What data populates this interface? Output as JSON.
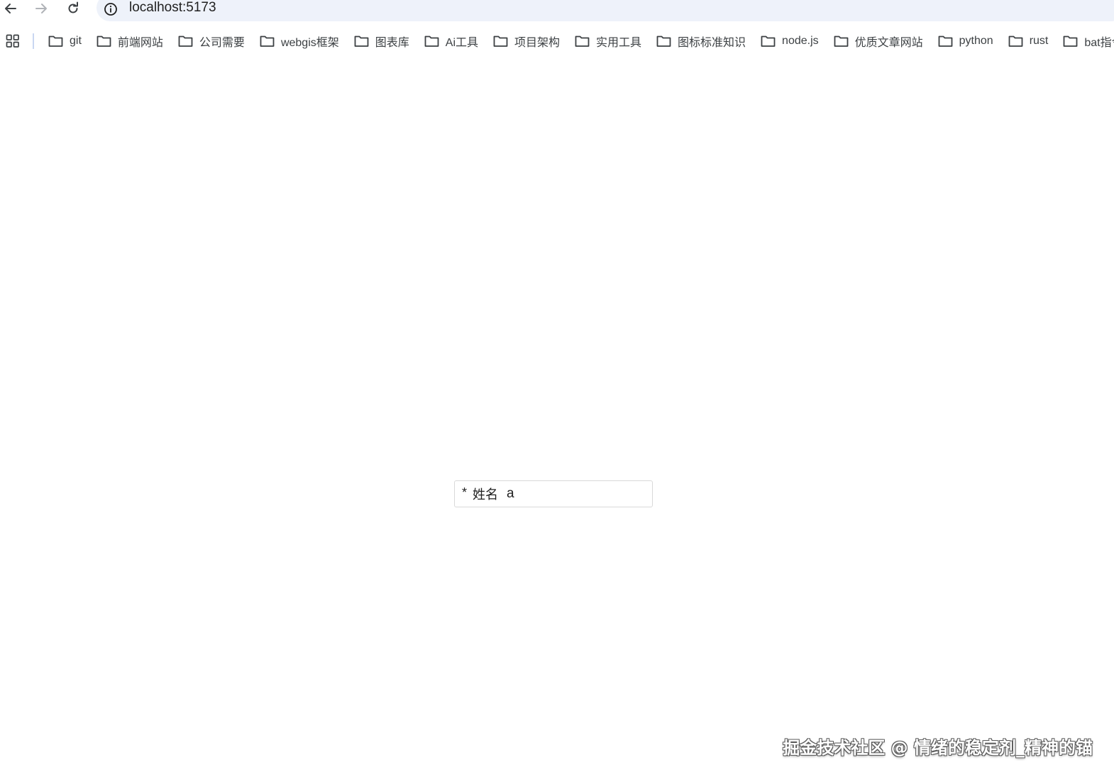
{
  "browser": {
    "url": "localhost:5173",
    "back_icon": "arrow-left-icon",
    "forward_icon": "arrow-right-icon",
    "reload_icon": "reload-icon",
    "site_info_icon": "info-icon"
  },
  "bookmarks": {
    "apps_icon": "apps-grid-icon",
    "items": [
      {
        "label": "git"
      },
      {
        "label": "前端网站"
      },
      {
        "label": "公司需要"
      },
      {
        "label": "webgis框架"
      },
      {
        "label": "图表库"
      },
      {
        "label": "Ai工具"
      },
      {
        "label": "项目架构"
      },
      {
        "label": "实用工具"
      },
      {
        "label": "图标标准知识"
      },
      {
        "label": "node.js"
      },
      {
        "label": "优质文章网站"
      },
      {
        "label": "python"
      },
      {
        "label": "rust"
      },
      {
        "label": "bat指令"
      }
    ]
  },
  "form": {
    "required_mark": "*",
    "name_label": "姓名",
    "name_value": "a"
  },
  "watermark": "掘金技术社区 @ 情绪的稳定剂_精神的锚",
  "colors": {
    "omnibox_bg": "#eef2fa",
    "input_border": "#d9d9d9",
    "bookmark_text": "#3c4043",
    "divider": "#c9d7f2"
  }
}
